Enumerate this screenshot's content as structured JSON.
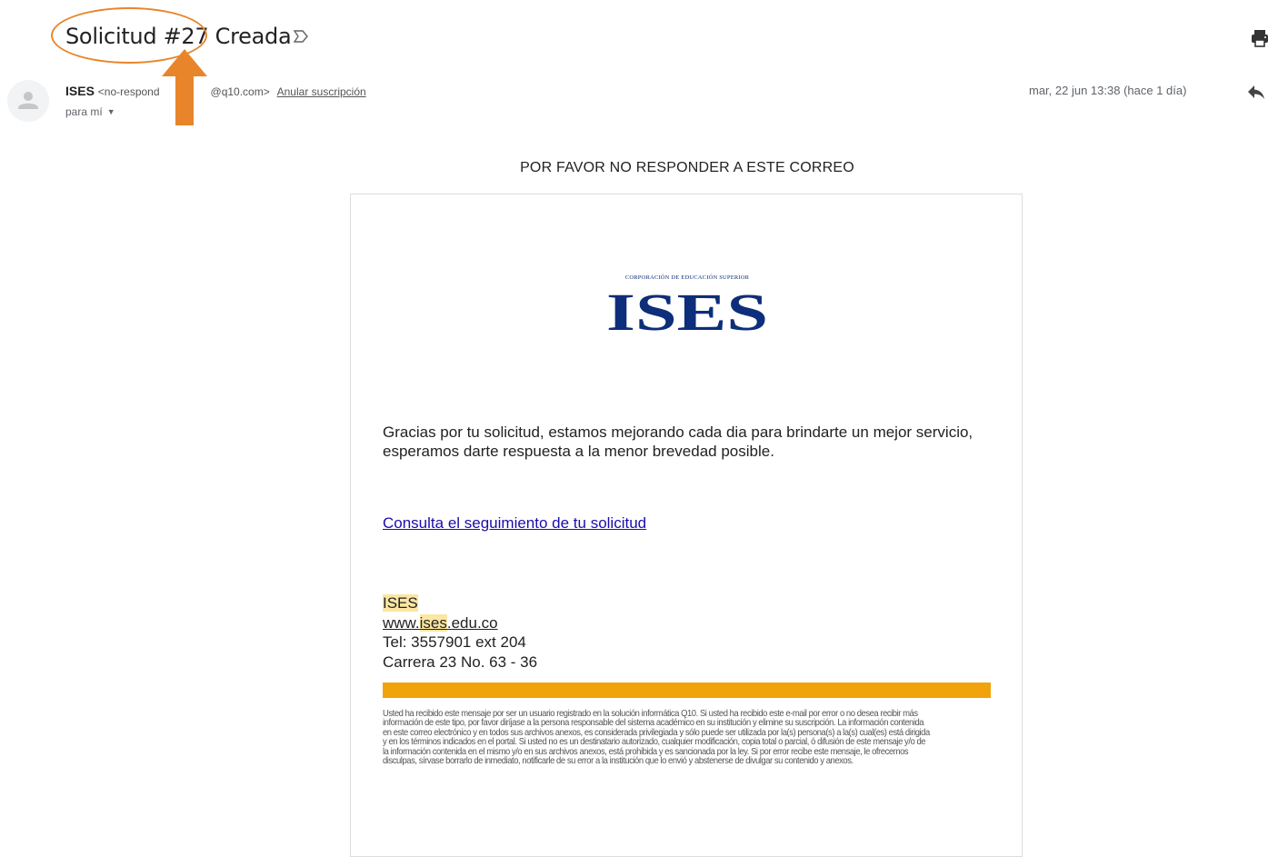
{
  "header": {
    "subject": "Solicitud #27 Creada",
    "label_icon": "label-arrow-icon",
    "print_icon": "printer-icon"
  },
  "sender": {
    "avatar_icon": "person-avatar-icon",
    "name": "ISES",
    "email_prefix": "<no-respond",
    "email_suffix": "@q10.com>",
    "unsubscribe_label": "Anular suscripción",
    "to_label": "para mí",
    "date": "mar, 22 jun 13:38 (hace 1 día)",
    "reply_icon": "reply-icon"
  },
  "email": {
    "no_reply_notice": "POR FAVOR NO RESPONDER A ESTE CORREO",
    "logo": {
      "tagline": "CORPORACIÓN DE EDUCACIÓN SUPERIOR",
      "wordmark": "ISES"
    },
    "thanks_text": "Gracias por tu solicitud, estamos mejorando cada dia para brindarte un mejor servicio, esperamos darte respuesta a la menor brevedad posible.",
    "tracking_link": "Consulta el seguimiento de  tu solicitud",
    "signature": {
      "name": "ISES",
      "web_prefix": "www.",
      "web_highlight": "ises",
      "web_suffix": ".edu.co",
      "tel": "Tel: 3557901 ext 204",
      "address": "Carrera 23 No. 63 - 36"
    },
    "disclaimer": "Usted ha recibido este mensaje por ser un usuario registrado en la solución informática Q10. Si usted ha recibido este e-mail por error o no desea recibir más información de este tipo, por favor diríjase a la persona responsable del sistema académico en su institución y elimine su suscripción. La información contenida en este correo electrónico y en todos sus archivos anexos, es considerada privilegiada y sólo puede ser utilizada por la(s) persona(s) a la(s) cual(es) está dirigida y en los términos indicados en el portal. Si usted no es un destinatario autorizado, cualquier modificación, copia total o parcial, ó difusión de este mensaje y/o de la información contenida en el mismo y/o en sus archivos anexos, está prohibida y es sancionada por la ley. Si por error recibe este mensaje, le ofrecemos disculpas, sírvase borrarlo de inmediato, notificarle de su error a la institución que lo envió y abstenerse de divulgar su contenido y anexos."
  },
  "colors": {
    "annotation_orange": "#e8852b",
    "brand_blue": "#0d2e7a",
    "footer_bar": "#f0a30a",
    "highlight": "#fbe6a2",
    "link": "#1a0dab"
  }
}
